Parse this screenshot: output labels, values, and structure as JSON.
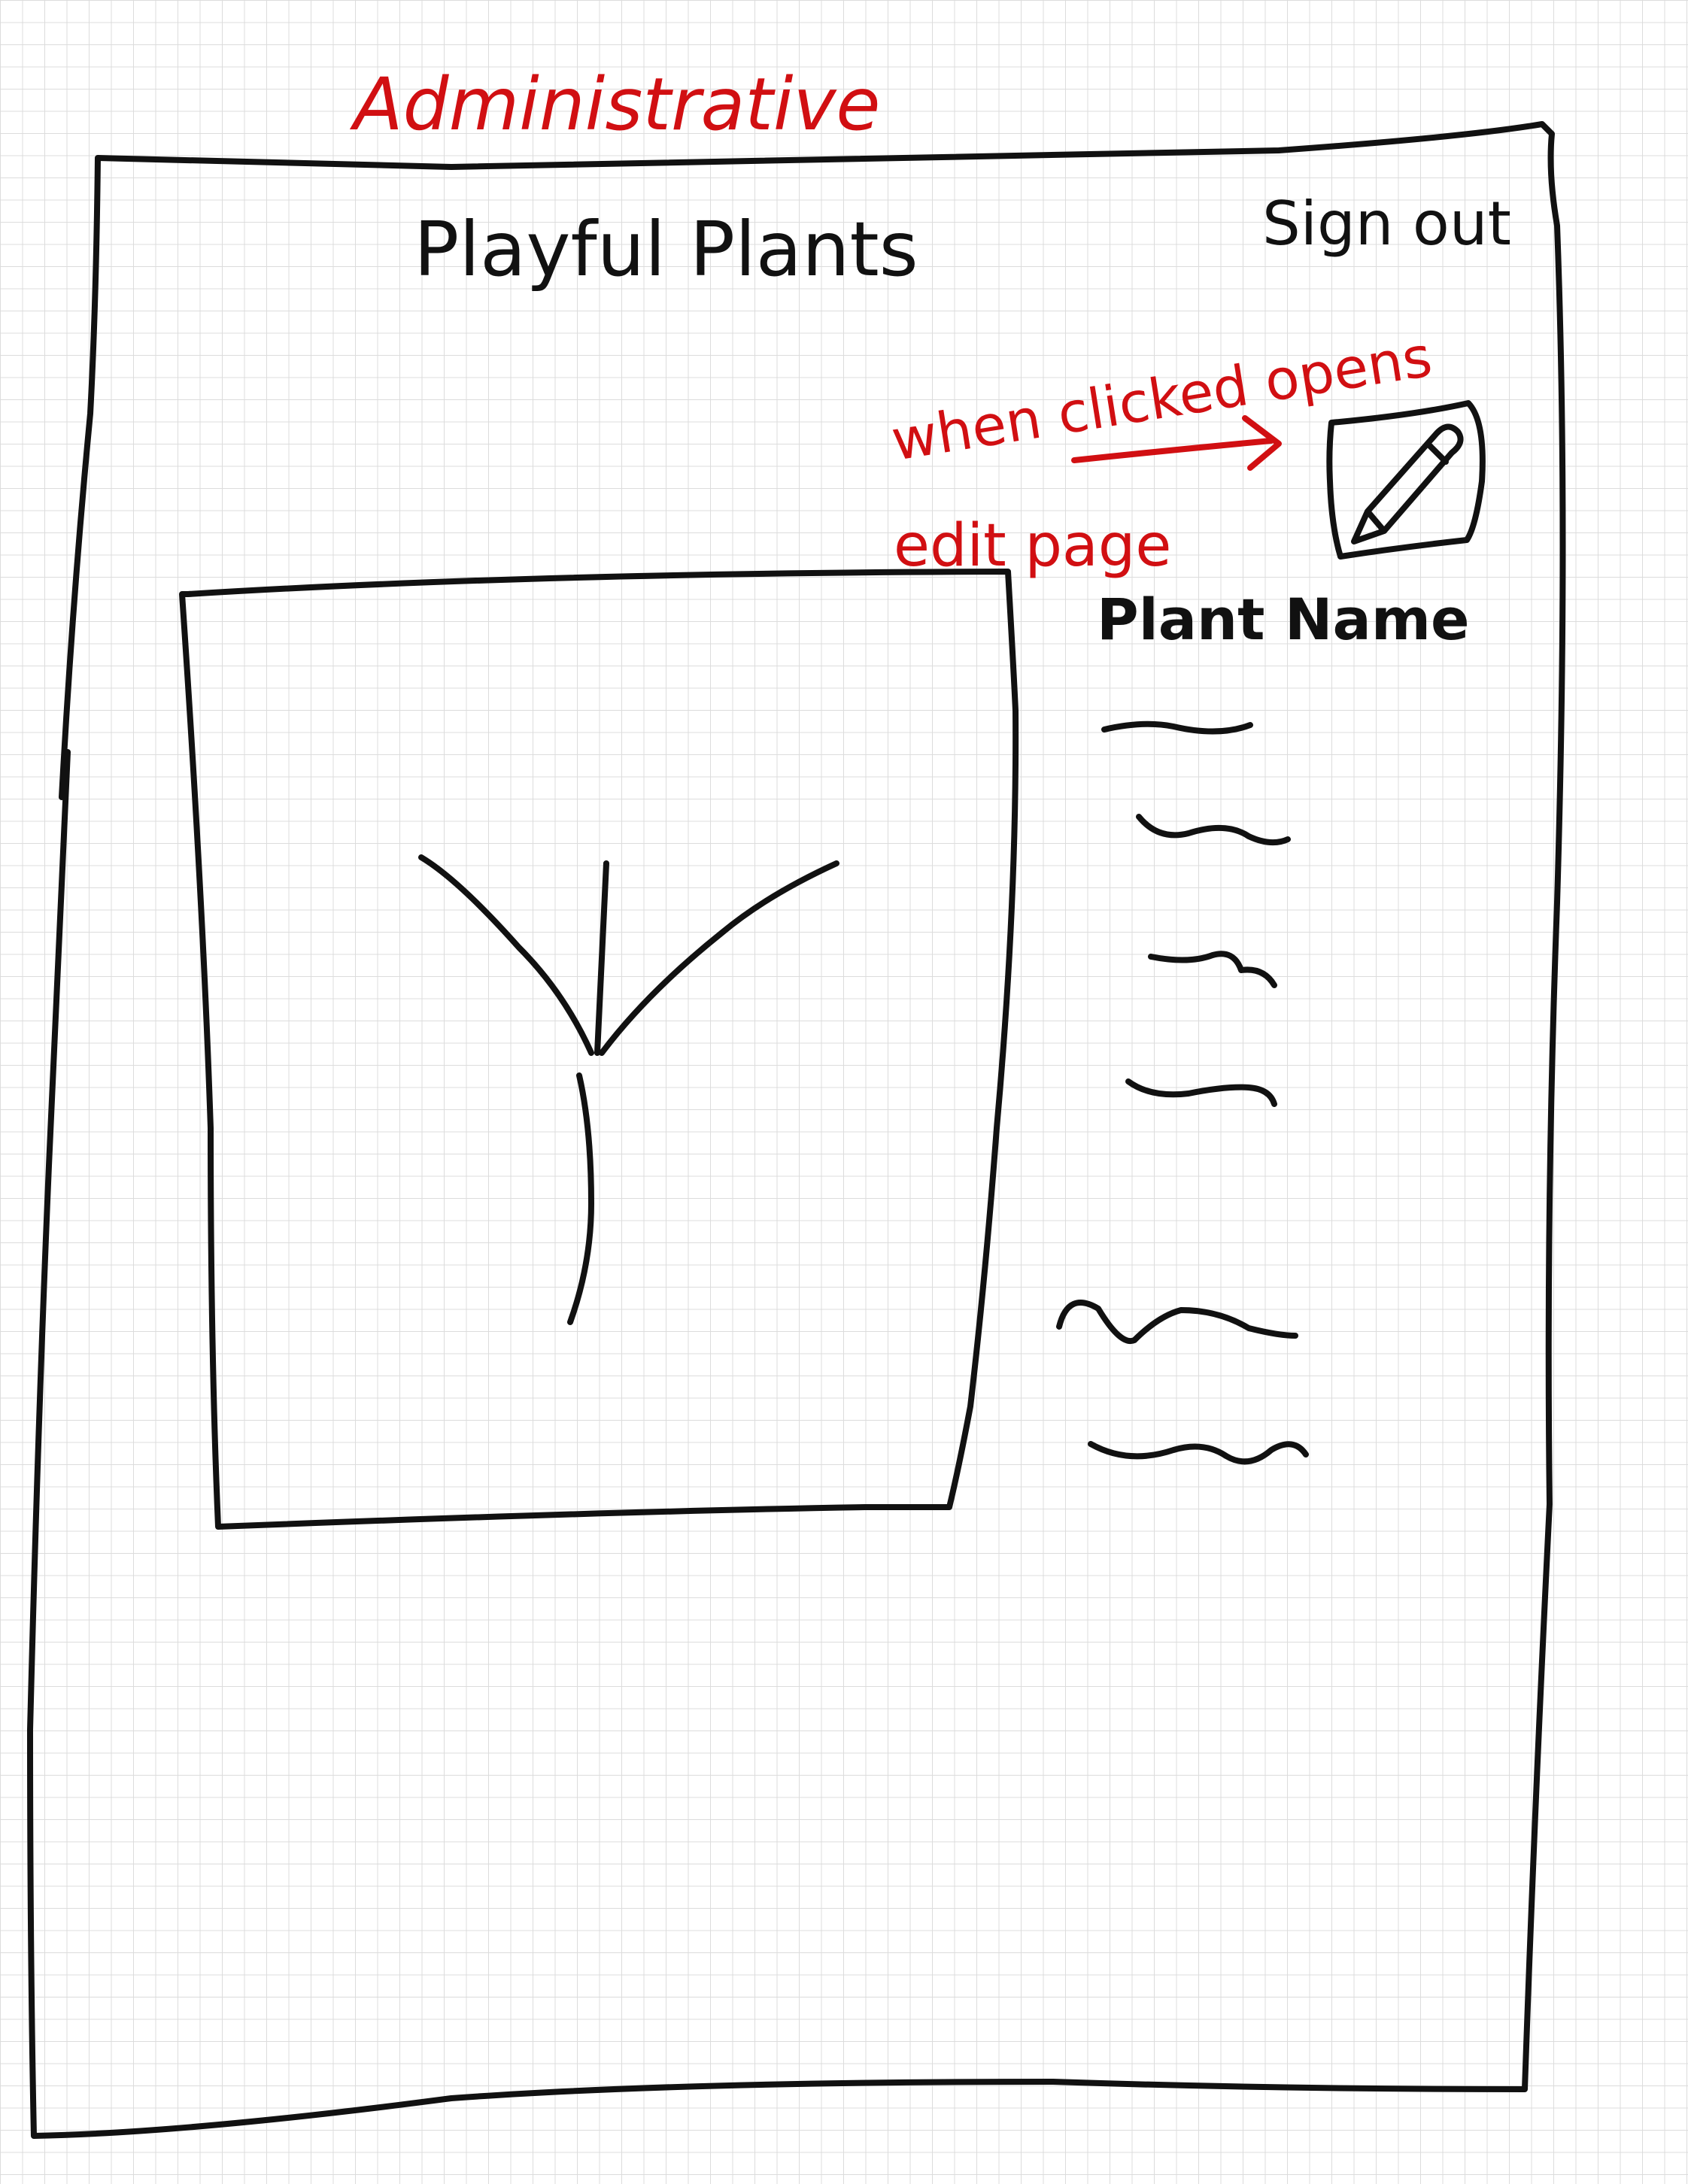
{
  "colors": {
    "ink": "#111111",
    "annotation": "#d10f12",
    "grid": "#dcdcdc",
    "paper": "#ffffff"
  },
  "annotation": {
    "screen_label": "Administrative",
    "edit_note_line1": "when clicked opens",
    "edit_note_line2": "edit page"
  },
  "header": {
    "site_title": "Playful Plants",
    "sign_out_label": "Sign out"
  },
  "plant": {
    "image_icon": "plant-sprout-icon",
    "edit_icon": "pencil-edit-icon",
    "name_label": "Plant Name",
    "detail_lines_count": 6
  }
}
